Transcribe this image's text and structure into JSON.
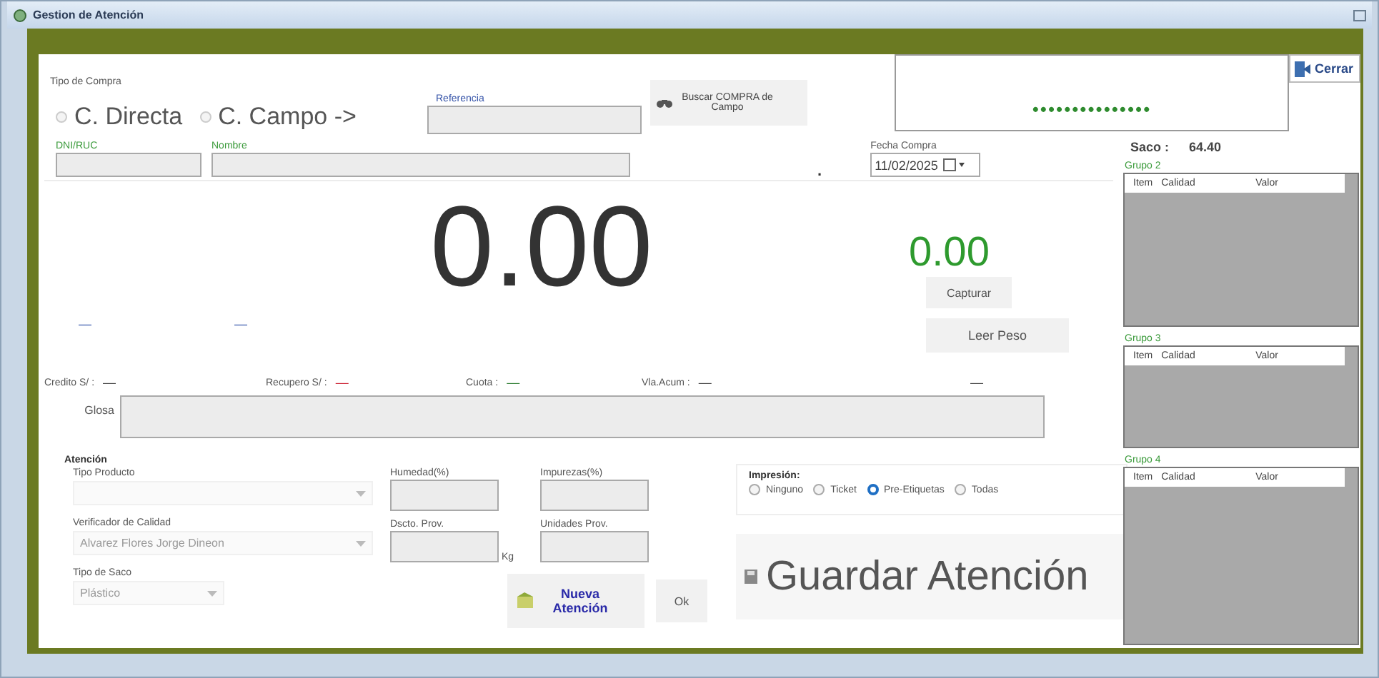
{
  "window": {
    "title": "Gestion de Atención"
  },
  "display_mask": "•••••••••••••••",
  "close_button": {
    "label": "Cerrar"
  },
  "purchase_type": {
    "label": "Tipo de Compra",
    "options": [
      {
        "label": "C. Directa",
        "selected": false
      },
      {
        "label": "C. Campo ->",
        "selected": false
      }
    ]
  },
  "reference": {
    "label": "Referencia"
  },
  "search_button": {
    "label": "Buscar COMPRA de Campo"
  },
  "dni": {
    "label": "DNI/RUC"
  },
  "name_field": {
    "label": "Nombre"
  },
  "dot_mark": ".",
  "date": {
    "label": "Fecha Compra",
    "value": "11/02/2025"
  },
  "weight": "0.00",
  "captured_weight": "0.00",
  "capture_button": "Capturar",
  "read_button": "Leer Peso",
  "dashes": [
    "—",
    "—"
  ],
  "summary": [
    {
      "label": "Credito S/ :",
      "value": "—",
      "color": "#444444"
    },
    {
      "label": "Recupero S/ :",
      "value": "—",
      "color": "#cc2233"
    },
    {
      "label": "Cuota :",
      "value": "—",
      "color": "#2e7d32"
    },
    {
      "label": "Vla.Acum :",
      "value": "—",
      "color": "#444444"
    }
  ],
  "extra_dash": "—",
  "glosa": {
    "label": "Glosa"
  },
  "attention": {
    "title": "Atención",
    "product_type": {
      "label": "Tipo Producto"
    },
    "humidity": {
      "label": "Humedad(%)"
    },
    "impurities": {
      "label": "Impurezas(%)"
    },
    "verifier": {
      "label": "Verificador de Calidad",
      "value": "Alvarez Flores Jorge Dineon"
    },
    "discount": {
      "label": "Dscto. Prov.",
      "unit": "Kg"
    },
    "units": {
      "label": "Unidades Prov."
    },
    "bag_type": {
      "label": "Tipo de Saco",
      "value": "Plástico"
    }
  },
  "new_button": "Nueva Atención",
  "ok_button": "Ok",
  "printing": {
    "label": "Impresión:",
    "options": [
      {
        "label": "Ninguno",
        "selected": false
      },
      {
        "label": "Ticket",
        "selected": false
      },
      {
        "label": "Pre-Etiquetas",
        "selected": true
      },
      {
        "label": "Todas",
        "selected": false
      }
    ]
  },
  "save_button": "Guardar Atención",
  "bag": {
    "label": "Saco :",
    "value": "64.40"
  },
  "groups": [
    {
      "title": "Grupo 2",
      "columns": [
        "Item",
        "Calidad",
        "Valor"
      ]
    },
    {
      "title": "Grupo 3",
      "columns": [
        "Item",
        "Calidad",
        "Valor"
      ]
    },
    {
      "title": "Grupo 4",
      "columns": [
        "Item",
        "Calidad",
        "Valor"
      ]
    }
  ]
}
